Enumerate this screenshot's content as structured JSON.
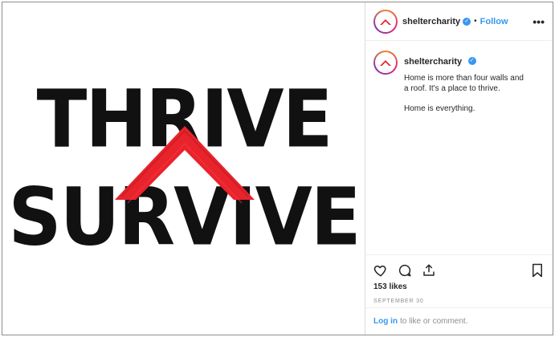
{
  "post": {
    "image": {
      "word_top": "THRIVE",
      "word_bottom": "SURVIVE",
      "mark_color": "#e8232c"
    },
    "header": {
      "username": "sheltercharity",
      "separator": "•",
      "follow_label": "Follow",
      "more_label": "•••"
    },
    "caption": {
      "username": "sheltercharity",
      "line1": "Home is more than four walls and a roof. It's a place to thrive.",
      "line2": "Home is everything."
    },
    "actions": {
      "icons": [
        "heart-icon",
        "comment-icon",
        "share-icon",
        "bookmark-icon"
      ],
      "likes": "153 likes",
      "date": "SEPTEMBER 30"
    },
    "login": {
      "link_label": "Log in",
      "suffix": "to like or comment."
    },
    "colors": {
      "accent": "#3897f0",
      "brand": "#e8232c",
      "text": "#262626",
      "muted": "#8e8e8e"
    }
  }
}
